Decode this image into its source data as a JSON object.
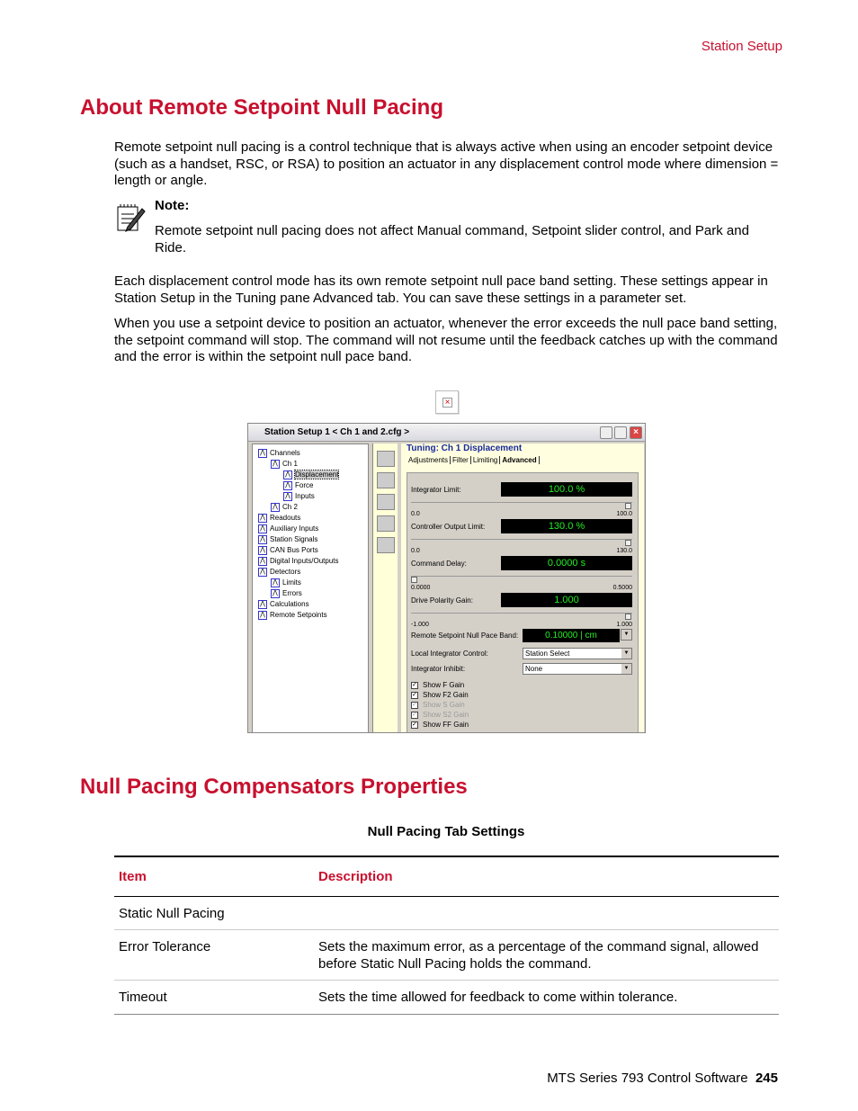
{
  "header": {
    "section": "Station Setup"
  },
  "section1": {
    "title": "About Remote Setpoint Null Pacing",
    "intro": "Remote setpoint null pacing is a control technique that is always active when using an encoder setpoint device (such as a handset, RSC, or RSA) to position an actuator in any displacement control mode where dimension = length or angle.",
    "note_label": "Note:",
    "note_text": "Remote setpoint null pacing does not affect Manual command, Setpoint slider control, and Park and Ride.",
    "para2": "Each displacement control mode has its own remote setpoint null pace band setting. These settings appear in Station Setup in the Tuning pane Advanced tab. You can save these settings in a parameter set.",
    "para3": "When you use a setpoint device to position an actuator, whenever the error exceeds the null pace band setting, the setpoint command will stop. The command will not resume until the feedback catches up with the command and the error is within the setpoint null pace band."
  },
  "window": {
    "title": "Station Setup 1 < Ch 1 and 2.cfg >",
    "tree": [
      {
        "label": "Channels",
        "indent": 0
      },
      {
        "label": "Ch 1",
        "indent": 1
      },
      {
        "label": "Displacement",
        "indent": 2,
        "selected": true
      },
      {
        "label": "Force",
        "indent": 2
      },
      {
        "label": "Inputs",
        "indent": 2
      },
      {
        "label": "Ch 2",
        "indent": 1
      },
      {
        "label": "Readouts",
        "indent": 0
      },
      {
        "label": "Auxiliary Inputs",
        "indent": 0
      },
      {
        "label": "Station Signals",
        "indent": 0
      },
      {
        "label": "CAN Bus Ports",
        "indent": 0
      },
      {
        "label": "Digital Inputs/Outputs",
        "indent": 0
      },
      {
        "label": "Detectors",
        "indent": 0
      },
      {
        "label": "Limits",
        "indent": 1
      },
      {
        "label": "Errors",
        "indent": 1
      },
      {
        "label": "Calculations",
        "indent": 0
      },
      {
        "label": "Remote Setpoints",
        "indent": 0
      }
    ],
    "pane_title": "Tuning:  Ch 1 Displacement",
    "tabs": [
      "Adjustments",
      "Filter",
      "Limiting",
      "Advanced"
    ],
    "active_tab": "Advanced",
    "integrator_limit": {
      "label": "Integrator Limit:",
      "value": "100.0  %",
      "min": "0.0",
      "max": "100.0",
      "level": 1.0
    },
    "controller_output_limit": {
      "label": "Controller Output Limit:",
      "value": "130.0  %",
      "min": "0.0",
      "max": "130.0",
      "level": 1.0
    },
    "command_delay": {
      "label": "Command Delay:",
      "value": "0.0000  s",
      "min": "0.0000",
      "max": "0.5000",
      "level": 0.0
    },
    "drive_polarity_gain": {
      "label": "Drive Polarity Gain:",
      "value": "1.000",
      "min": "-1.000",
      "max": "1.000",
      "level": 1.0
    },
    "null_pace_band": {
      "label": "Remote Setpoint Null Pace Band:",
      "value": "0.10000",
      "unit": "cm"
    },
    "local_integrator_control": {
      "label": "Local Integrator Control:",
      "value": "Station Select"
    },
    "integrator_inhibit": {
      "label": "Integrator Inhibit:",
      "value": "None"
    },
    "checkboxes": [
      {
        "label": "Show F Gain",
        "checked": true,
        "enabled": true
      },
      {
        "label": "Show F2 Gain",
        "checked": true,
        "enabled": true
      },
      {
        "label": "Show S Gain",
        "checked": true,
        "enabled": false
      },
      {
        "label": "Show S2 Gain",
        "checked": true,
        "enabled": false
      },
      {
        "label": "Show FF Gain",
        "checked": true,
        "enabled": true
      }
    ]
  },
  "section2": {
    "title": "Null Pacing Compensators Properties",
    "caption": "Null Pacing Tab Settings",
    "columns": [
      "Item",
      "Description"
    ],
    "rows": [
      [
        "Static Null Pacing",
        ""
      ],
      [
        "Error Tolerance",
        "Sets the maximum error, as a percentage of the command signal, allowed before Static Null Pacing holds the command."
      ],
      [
        "Timeout",
        "Sets the time allowed for feedback to come within tolerance."
      ]
    ]
  },
  "footer": {
    "product": "MTS Series 793 Control Software",
    "page": "245"
  },
  "colors": {
    "accent": "#c8102e",
    "display_text": "#22ee22"
  }
}
